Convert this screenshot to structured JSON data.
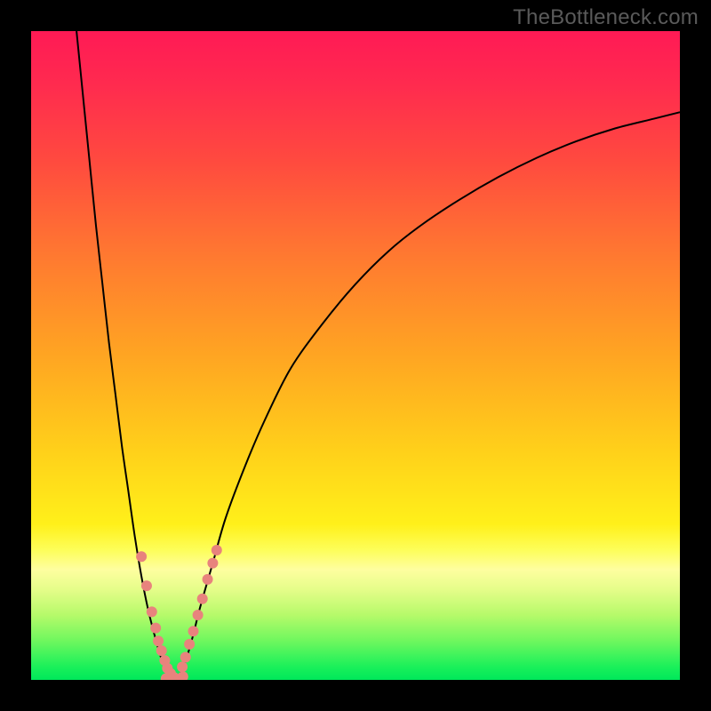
{
  "watermark": "TheBottleneck.com",
  "chart_data": {
    "type": "line",
    "title": "",
    "xlabel": "",
    "ylabel": "",
    "xlim": [
      0,
      100
    ],
    "ylim": [
      0,
      100
    ],
    "curve": {
      "x": [
        7,
        8,
        9,
        10,
        11,
        12,
        13,
        14,
        15,
        16,
        17,
        18,
        19,
        20,
        21,
        22,
        23,
        24,
        25,
        26,
        28,
        30,
        33,
        36,
        40,
        45,
        50,
        55,
        60,
        66,
        72,
        78,
        84,
        90,
        96,
        100
      ],
      "y": [
        100,
        90,
        80,
        70,
        61,
        52,
        44,
        36,
        29,
        22,
        16,
        11,
        7,
        3.5,
        1.0,
        0,
        1.0,
        3.5,
        7,
        11,
        18,
        25,
        33,
        40,
        48,
        55,
        61,
        66,
        70,
        74,
        77.5,
        80.5,
        83,
        85,
        86.5,
        87.5
      ]
    },
    "dots_left": {
      "x": [
        17.0,
        17.8,
        18.6,
        19.2,
        19.6,
        20.1,
        20.6,
        21.0,
        21.5,
        22.0
      ],
      "y": [
        19.0,
        14.5,
        10.5,
        8.0,
        6.0,
        4.5,
        3.0,
        1.8,
        1.0,
        0.4
      ]
    },
    "dots_right": {
      "x": [
        23.3,
        23.8,
        24.4,
        25.0,
        25.7,
        26.4,
        27.2,
        28.0,
        28.6
      ],
      "y": [
        2.0,
        3.5,
        5.5,
        7.5,
        10.0,
        12.5,
        15.5,
        18.0,
        20.0
      ]
    },
    "bottom_dots": {
      "x": [
        20.8,
        21.6,
        22.2,
        22.8,
        23.4
      ],
      "y": [
        0.2,
        0.05,
        0.0,
        0.1,
        0.5
      ]
    },
    "dot_style": {
      "fill": "#e8837d",
      "r": 6
    },
    "curve_style": {
      "stroke": "#000000",
      "width": 2
    }
  }
}
